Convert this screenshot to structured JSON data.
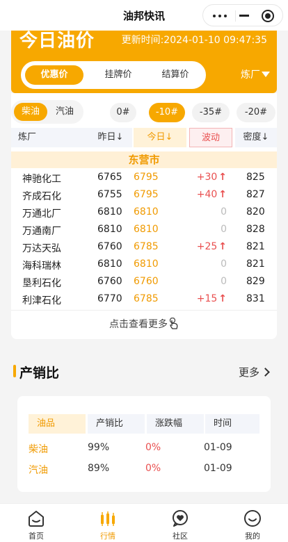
{
  "app": {
    "title": "油邦快讯"
  },
  "hero": {
    "title": "今日油价",
    "update_label": "更新时间:2024-01-10 09:47:35",
    "price_tabs": [
      "优惠价",
      "挂牌价",
      "结算价"
    ],
    "active_price_tab": 0,
    "refinery_filter": "炼厂"
  },
  "fuel": {
    "types": [
      "柴油",
      "汽油"
    ],
    "active": 0
  },
  "grades": {
    "items": [
      "0#",
      "-10#",
      "-35#",
      "-20#"
    ],
    "active": 1
  },
  "table": {
    "headers": {
      "refinery": "炼厂",
      "yesterday": "昨日↓",
      "today": "今日↓",
      "change": "波动",
      "density": "密度↓"
    },
    "city": "东营市",
    "rows": [
      {
        "refinery": "神驰化工",
        "yesterday": "6765",
        "today": "6795",
        "change": "+30",
        "trend": "up",
        "density": "825"
      },
      {
        "refinery": "齐成石化",
        "yesterday": "6755",
        "today": "6795",
        "change": "+40",
        "trend": "up",
        "density": "827"
      },
      {
        "refinery": "万通北厂",
        "yesterday": "6810",
        "today": "6810",
        "change": "0",
        "trend": "flat",
        "density": "820"
      },
      {
        "refinery": "万通南厂",
        "yesterday": "6810",
        "today": "6810",
        "change": "0",
        "trend": "flat",
        "density": "828"
      },
      {
        "refinery": "万达天弘",
        "yesterday": "6760",
        "today": "6785",
        "change": "+25",
        "trend": "up",
        "density": "821"
      },
      {
        "refinery": "海科瑞林",
        "yesterday": "6810",
        "today": "6810",
        "change": "0",
        "trend": "flat",
        "density": "821"
      },
      {
        "refinery": "垦利石化",
        "yesterday": "6760",
        "today": "6760",
        "change": "0",
        "trend": "flat",
        "density": "829"
      },
      {
        "refinery": "利津石化",
        "yesterday": "6770",
        "today": "6785",
        "change": "+15",
        "trend": "up",
        "density": "831"
      }
    ],
    "up_arrow": "↑",
    "more_label": "点击查看更多"
  },
  "ratio": {
    "title": "产销比",
    "more_label": "更多",
    "headers": [
      "油品",
      "产销比",
      "涨跌幅",
      "时间"
    ],
    "rows": [
      {
        "product": "柴油",
        "ratio": "99%",
        "change": "0%",
        "date": "01-09"
      },
      {
        "product": "汽油",
        "ratio": "89%",
        "change": "0%",
        "date": "01-09"
      }
    ]
  },
  "tabbar": {
    "items": [
      {
        "label": "首页",
        "icon": "home-icon"
      },
      {
        "label": "行情",
        "icon": "candlestick-icon"
      },
      {
        "label": "社区",
        "icon": "community-icon"
      },
      {
        "label": "我的",
        "icon": "smiley-icon"
      }
    ],
    "active": 1
  },
  "colors": {
    "accent": "#f7a800",
    "up": "#e94f4f",
    "accent_text": "#f09a00"
  }
}
